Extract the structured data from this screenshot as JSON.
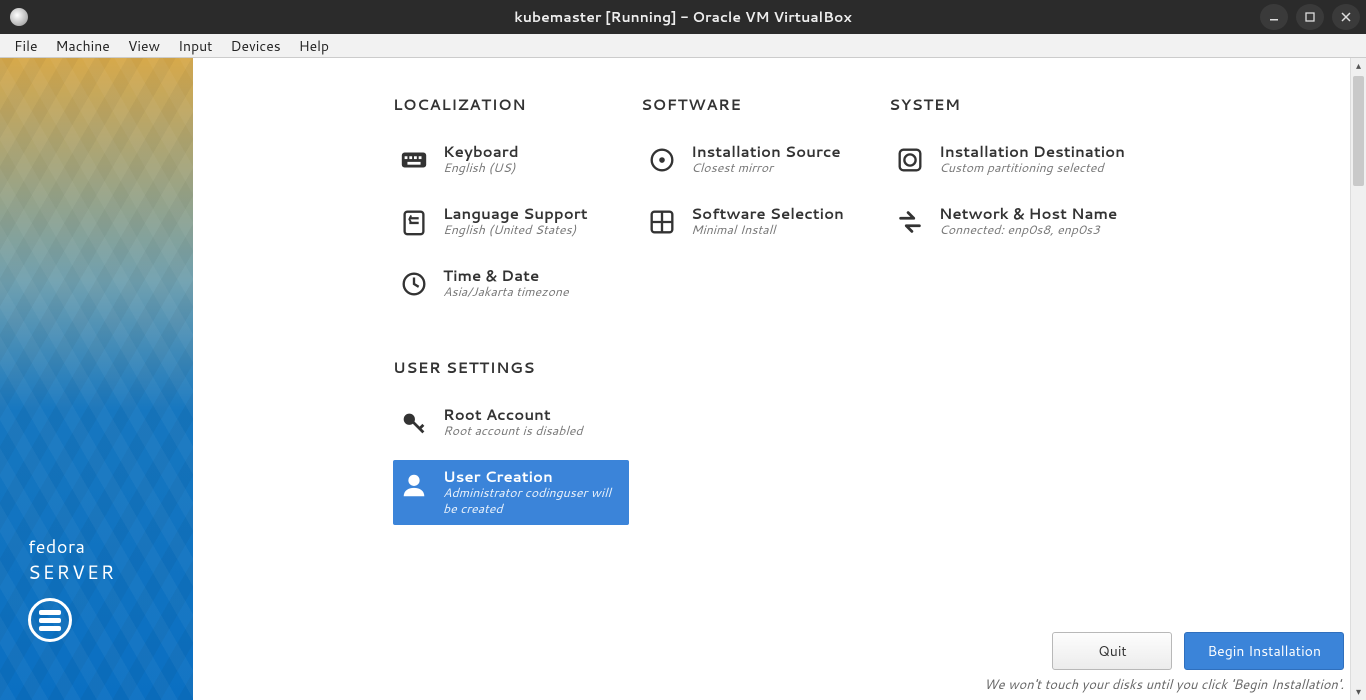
{
  "window": {
    "title": "kubemaster [Running] - Oracle VM VirtualBox"
  },
  "menubar": [
    "File",
    "Machine",
    "View",
    "Input",
    "Devices",
    "Help"
  ],
  "brand": {
    "line1": "fedora",
    "line2": "SERVER"
  },
  "sections": {
    "localization": {
      "heading": "LOCALIZATION",
      "keyboard": {
        "title": "Keyboard",
        "sub": "English (US)"
      },
      "language": {
        "title": "Language Support",
        "sub": "English (United States)"
      },
      "time": {
        "title": "Time & Date",
        "sub": "Asia/Jakarta timezone"
      }
    },
    "software": {
      "heading": "SOFTWARE",
      "source": {
        "title": "Installation Source",
        "sub": "Closest mirror"
      },
      "selection": {
        "title": "Software Selection",
        "sub": "Minimal Install"
      }
    },
    "system": {
      "heading": "SYSTEM",
      "destination": {
        "title": "Installation Destination",
        "sub": "Custom partitioning selected"
      },
      "network": {
        "title": "Network & Host Name",
        "sub": "Connected: enp0s8, enp0s3"
      }
    },
    "user": {
      "heading": "USER SETTINGS",
      "root": {
        "title": "Root Account",
        "sub": "Root account is disabled"
      },
      "creation": {
        "title": "User Creation",
        "sub": "Administrator codinguser will be created"
      }
    }
  },
  "buttons": {
    "quit": "Quit",
    "begin": "Begin Installation"
  },
  "footnote": "We won't touch your disks until you click 'Begin Installation'."
}
